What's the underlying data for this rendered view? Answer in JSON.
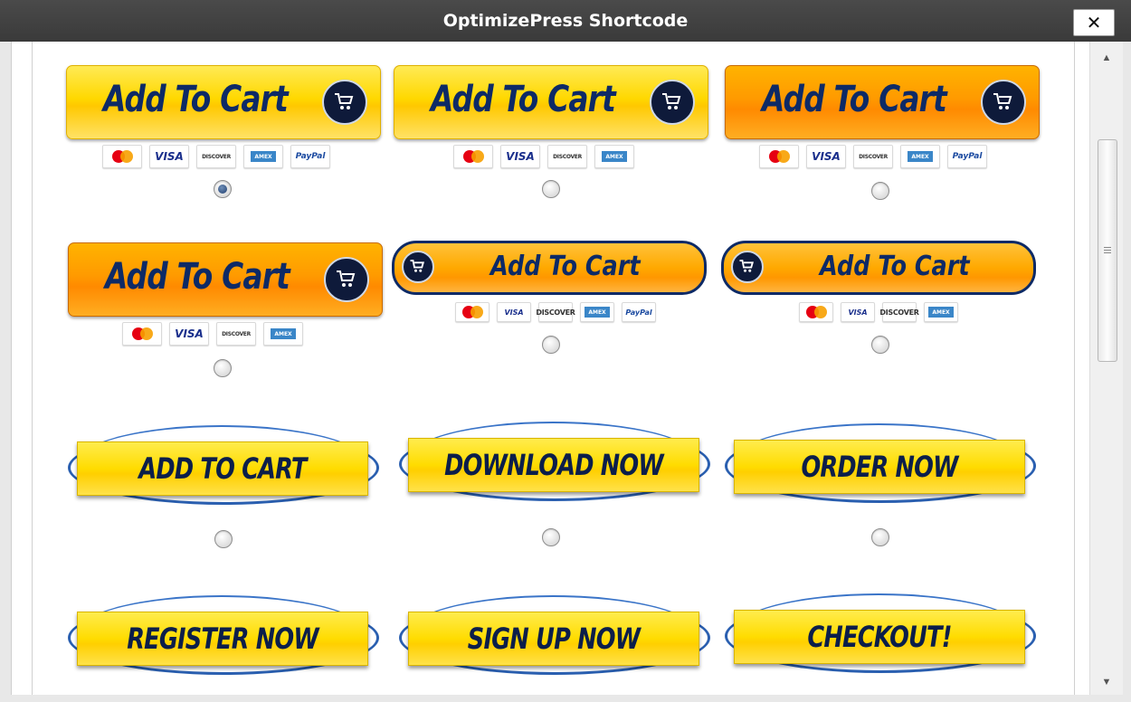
{
  "dialog": {
    "title": "OptimizePress Shortcode",
    "close_label": "✕"
  },
  "payment_icons": {
    "visa": "VISA",
    "discover": "DISCOVER",
    "amex": "AMEX",
    "paypal": "PayPal"
  },
  "buttons": [
    {
      "label": "Add To Cart",
      "style": "yellow",
      "cards": 5,
      "selected": true
    },
    {
      "label": "Add To Cart",
      "style": "yellow",
      "cards": 4,
      "selected": false
    },
    {
      "label": "Add To Cart",
      "style": "orange",
      "cards": 5,
      "selected": false
    },
    {
      "label": "Add To Cart",
      "style": "orange",
      "cards": 4,
      "selected": false
    },
    {
      "label": "Add To Cart",
      "style": "pill",
      "cards": 5,
      "selected": false
    },
    {
      "label": "Add To Cart",
      "style": "pill",
      "cards": 4,
      "selected": false
    },
    {
      "label": "ADD TO CART",
      "style": "swoosh",
      "selected": false
    },
    {
      "label": "DOWNLOAD NOW",
      "style": "swoosh",
      "selected": false
    },
    {
      "label": "ORDER NOW",
      "style": "swoosh",
      "selected": false
    },
    {
      "label": "REGISTER NOW",
      "style": "swoosh",
      "selected": false
    },
    {
      "label": "SIGN UP NOW",
      "style": "swoosh",
      "selected": false
    },
    {
      "label": "CHECKOUT!",
      "style": "swoosh",
      "selected": false
    }
  ],
  "colors": {
    "titlebar": "#3f3f3f",
    "button_text": "#0d2a66",
    "yellow": "#ffd800",
    "orange": "#ff9a00",
    "swoosh_blue": "#2a5fb0"
  }
}
